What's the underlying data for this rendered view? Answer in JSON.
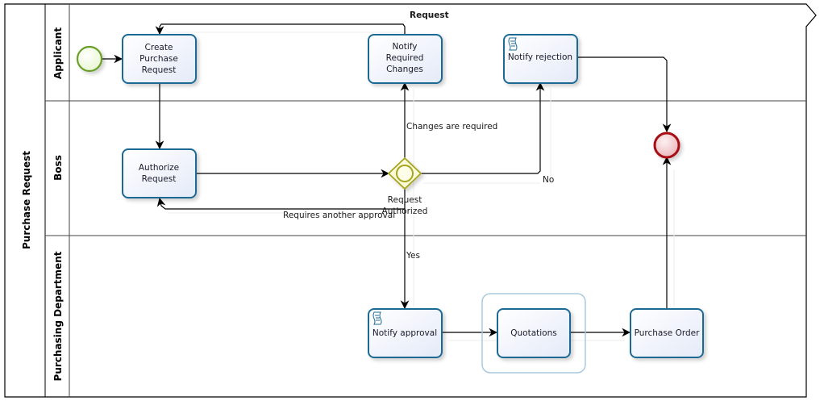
{
  "pool": {
    "name": "Purchase Request"
  },
  "lanes": [
    {
      "id": "applicant",
      "name": "Applicant"
    },
    {
      "id": "boss",
      "name": "Boss"
    },
    {
      "id": "purchasing",
      "name": "Purchasing Department"
    }
  ],
  "tasks": {
    "create_purchase_request": {
      "lines": [
        "Create",
        "Purchase",
        "Request"
      ],
      "lane": "applicant"
    },
    "notify_required_changes": {
      "lines": [
        "Notify",
        "Required",
        "Changes"
      ],
      "lane": "applicant"
    },
    "notify_rejection": {
      "lines": [
        "Notify rejection"
      ],
      "lane": "applicant",
      "marker": "script"
    },
    "authorize_request": {
      "lines": [
        "Authorize",
        "Request"
      ],
      "lane": "boss"
    },
    "notify_approval": {
      "lines": [
        "Notify approval"
      ],
      "lane": "purchasing",
      "marker": "script"
    },
    "quotations": {
      "lines": [
        "Quotations"
      ],
      "lane": "purchasing",
      "grouped": true
    },
    "purchase_order": {
      "lines": [
        "Purchase Order"
      ],
      "lane": "purchasing"
    }
  },
  "gateway": {
    "lines": [
      "Request",
      "Authorized"
    ],
    "type": "inclusive"
  },
  "events": {
    "start": {
      "type": "start"
    },
    "end": {
      "type": "end"
    }
  },
  "flows": {
    "request": "Request",
    "changes_required": "Changes are required",
    "no": "No",
    "yes": "Yes",
    "requires_another_approval": "Requires another approval"
  },
  "colors": {
    "task_stroke": "#1f6b94",
    "task_fill": "#eef2fb",
    "start_stroke": "#6aa02a",
    "start_fill": "#f2fbe4",
    "end_stroke": "#a80f12",
    "end_fill": "#f6d2d5",
    "gateway_stroke": "#a7a51c",
    "gateway_fill": "#fbfbdc",
    "group_stroke": "#a9cadc"
  }
}
